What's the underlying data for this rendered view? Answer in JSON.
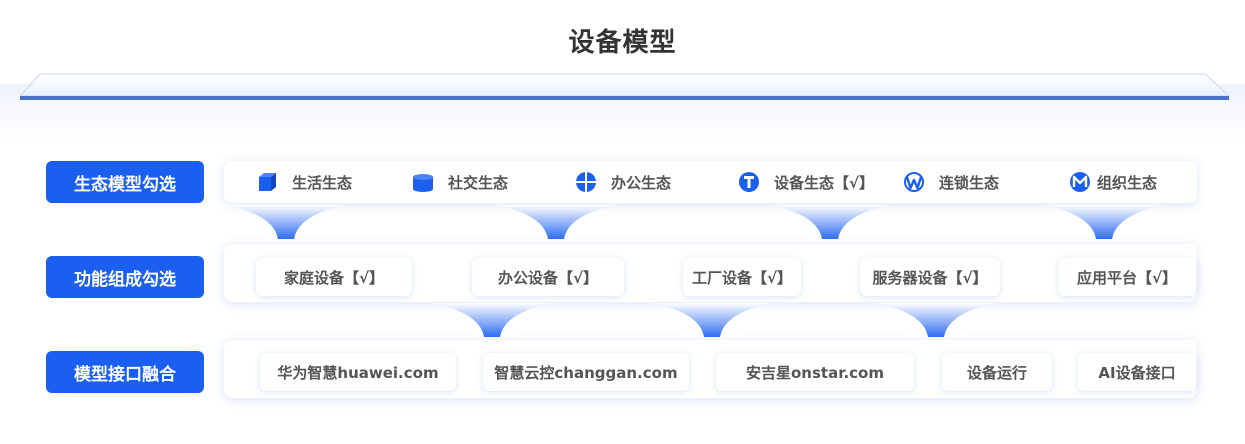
{
  "title": "设备模型",
  "accent_color": "#1a5ff0",
  "rows": [
    {
      "label": "生态模型勾选",
      "items": [
        {
          "label": "生活生态",
          "icon": "cube-icon"
        },
        {
          "label": "社交生态",
          "icon": "database-icon"
        },
        {
          "label": "办公生态",
          "icon": "globe-icon"
        },
        {
          "label": "设备生态【√】",
          "icon": "letter-t-icon"
        },
        {
          "label": "连锁生态",
          "icon": "letter-w-icon"
        },
        {
          "label": "组织生态",
          "icon": "letter-m-icon"
        }
      ]
    },
    {
      "label": "功能组成勾选",
      "items": [
        {
          "label": "家庭设备【√】"
        },
        {
          "label": "办公设备【√】"
        },
        {
          "label": "工厂设备【√】"
        },
        {
          "label": "服务器设备【√】"
        },
        {
          "label": "应用平台【√】"
        }
      ]
    },
    {
      "label": "模型接口融合",
      "items": [
        {
          "label": "华为智慧huawei.com"
        },
        {
          "label": "智慧云控changgan.com"
        },
        {
          "label": "安吉星onstar.com"
        },
        {
          "label": "设备运行"
        },
        {
          "label": "AI设备接口"
        }
      ]
    }
  ]
}
